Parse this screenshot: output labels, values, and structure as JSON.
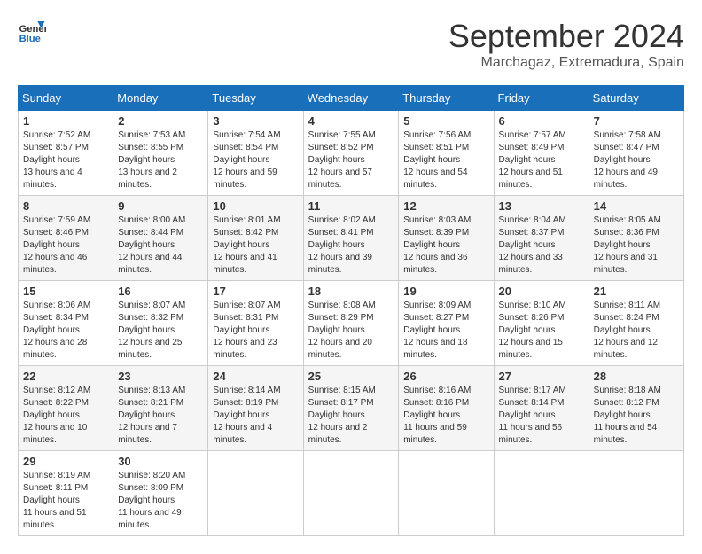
{
  "header": {
    "logo_line1": "General",
    "logo_line2": "Blue",
    "month_year": "September 2024",
    "location": "Marchagaz, Extremadura, Spain"
  },
  "weekdays": [
    "Sunday",
    "Monday",
    "Tuesday",
    "Wednesday",
    "Thursday",
    "Friday",
    "Saturday"
  ],
  "weeks": [
    [
      {
        "day": "1",
        "sunrise": "7:52 AM",
        "sunset": "8:57 PM",
        "daylight": "13 hours and 4 minutes."
      },
      {
        "day": "2",
        "sunrise": "7:53 AM",
        "sunset": "8:55 PM",
        "daylight": "13 hours and 2 minutes."
      },
      {
        "day": "3",
        "sunrise": "7:54 AM",
        "sunset": "8:54 PM",
        "daylight": "12 hours and 59 minutes."
      },
      {
        "day": "4",
        "sunrise": "7:55 AM",
        "sunset": "8:52 PM",
        "daylight": "12 hours and 57 minutes."
      },
      {
        "day": "5",
        "sunrise": "7:56 AM",
        "sunset": "8:51 PM",
        "daylight": "12 hours and 54 minutes."
      },
      {
        "day": "6",
        "sunrise": "7:57 AM",
        "sunset": "8:49 PM",
        "daylight": "12 hours and 51 minutes."
      },
      {
        "day": "7",
        "sunrise": "7:58 AM",
        "sunset": "8:47 PM",
        "daylight": "12 hours and 49 minutes."
      }
    ],
    [
      {
        "day": "8",
        "sunrise": "7:59 AM",
        "sunset": "8:46 PM",
        "daylight": "12 hours and 46 minutes."
      },
      {
        "day": "9",
        "sunrise": "8:00 AM",
        "sunset": "8:44 PM",
        "daylight": "12 hours and 44 minutes."
      },
      {
        "day": "10",
        "sunrise": "8:01 AM",
        "sunset": "8:42 PM",
        "daylight": "12 hours and 41 minutes."
      },
      {
        "day": "11",
        "sunrise": "8:02 AM",
        "sunset": "8:41 PM",
        "daylight": "12 hours and 39 minutes."
      },
      {
        "day": "12",
        "sunrise": "8:03 AM",
        "sunset": "8:39 PM",
        "daylight": "12 hours and 36 minutes."
      },
      {
        "day": "13",
        "sunrise": "8:04 AM",
        "sunset": "8:37 PM",
        "daylight": "12 hours and 33 minutes."
      },
      {
        "day": "14",
        "sunrise": "8:05 AM",
        "sunset": "8:36 PM",
        "daylight": "12 hours and 31 minutes."
      }
    ],
    [
      {
        "day": "15",
        "sunrise": "8:06 AM",
        "sunset": "8:34 PM",
        "daylight": "12 hours and 28 minutes."
      },
      {
        "day": "16",
        "sunrise": "8:07 AM",
        "sunset": "8:32 PM",
        "daylight": "12 hours and 25 minutes."
      },
      {
        "day": "17",
        "sunrise": "8:07 AM",
        "sunset": "8:31 PM",
        "daylight": "12 hours and 23 minutes."
      },
      {
        "day": "18",
        "sunrise": "8:08 AM",
        "sunset": "8:29 PM",
        "daylight": "12 hours and 20 minutes."
      },
      {
        "day": "19",
        "sunrise": "8:09 AM",
        "sunset": "8:27 PM",
        "daylight": "12 hours and 18 minutes."
      },
      {
        "day": "20",
        "sunrise": "8:10 AM",
        "sunset": "8:26 PM",
        "daylight": "12 hours and 15 minutes."
      },
      {
        "day": "21",
        "sunrise": "8:11 AM",
        "sunset": "8:24 PM",
        "daylight": "12 hours and 12 minutes."
      }
    ],
    [
      {
        "day": "22",
        "sunrise": "8:12 AM",
        "sunset": "8:22 PM",
        "daylight": "12 hours and 10 minutes."
      },
      {
        "day": "23",
        "sunrise": "8:13 AM",
        "sunset": "8:21 PM",
        "daylight": "12 hours and 7 minutes."
      },
      {
        "day": "24",
        "sunrise": "8:14 AM",
        "sunset": "8:19 PM",
        "daylight": "12 hours and 4 minutes."
      },
      {
        "day": "25",
        "sunrise": "8:15 AM",
        "sunset": "8:17 PM",
        "daylight": "12 hours and 2 minutes."
      },
      {
        "day": "26",
        "sunrise": "8:16 AM",
        "sunset": "8:16 PM",
        "daylight": "11 hours and 59 minutes."
      },
      {
        "day": "27",
        "sunrise": "8:17 AM",
        "sunset": "8:14 PM",
        "daylight": "11 hours and 56 minutes."
      },
      {
        "day": "28",
        "sunrise": "8:18 AM",
        "sunset": "8:12 PM",
        "daylight": "11 hours and 54 minutes."
      }
    ],
    [
      {
        "day": "29",
        "sunrise": "8:19 AM",
        "sunset": "8:11 PM",
        "daylight": "11 hours and 51 minutes."
      },
      {
        "day": "30",
        "sunrise": "8:20 AM",
        "sunset": "8:09 PM",
        "daylight": "11 hours and 49 minutes."
      },
      null,
      null,
      null,
      null,
      null
    ]
  ]
}
